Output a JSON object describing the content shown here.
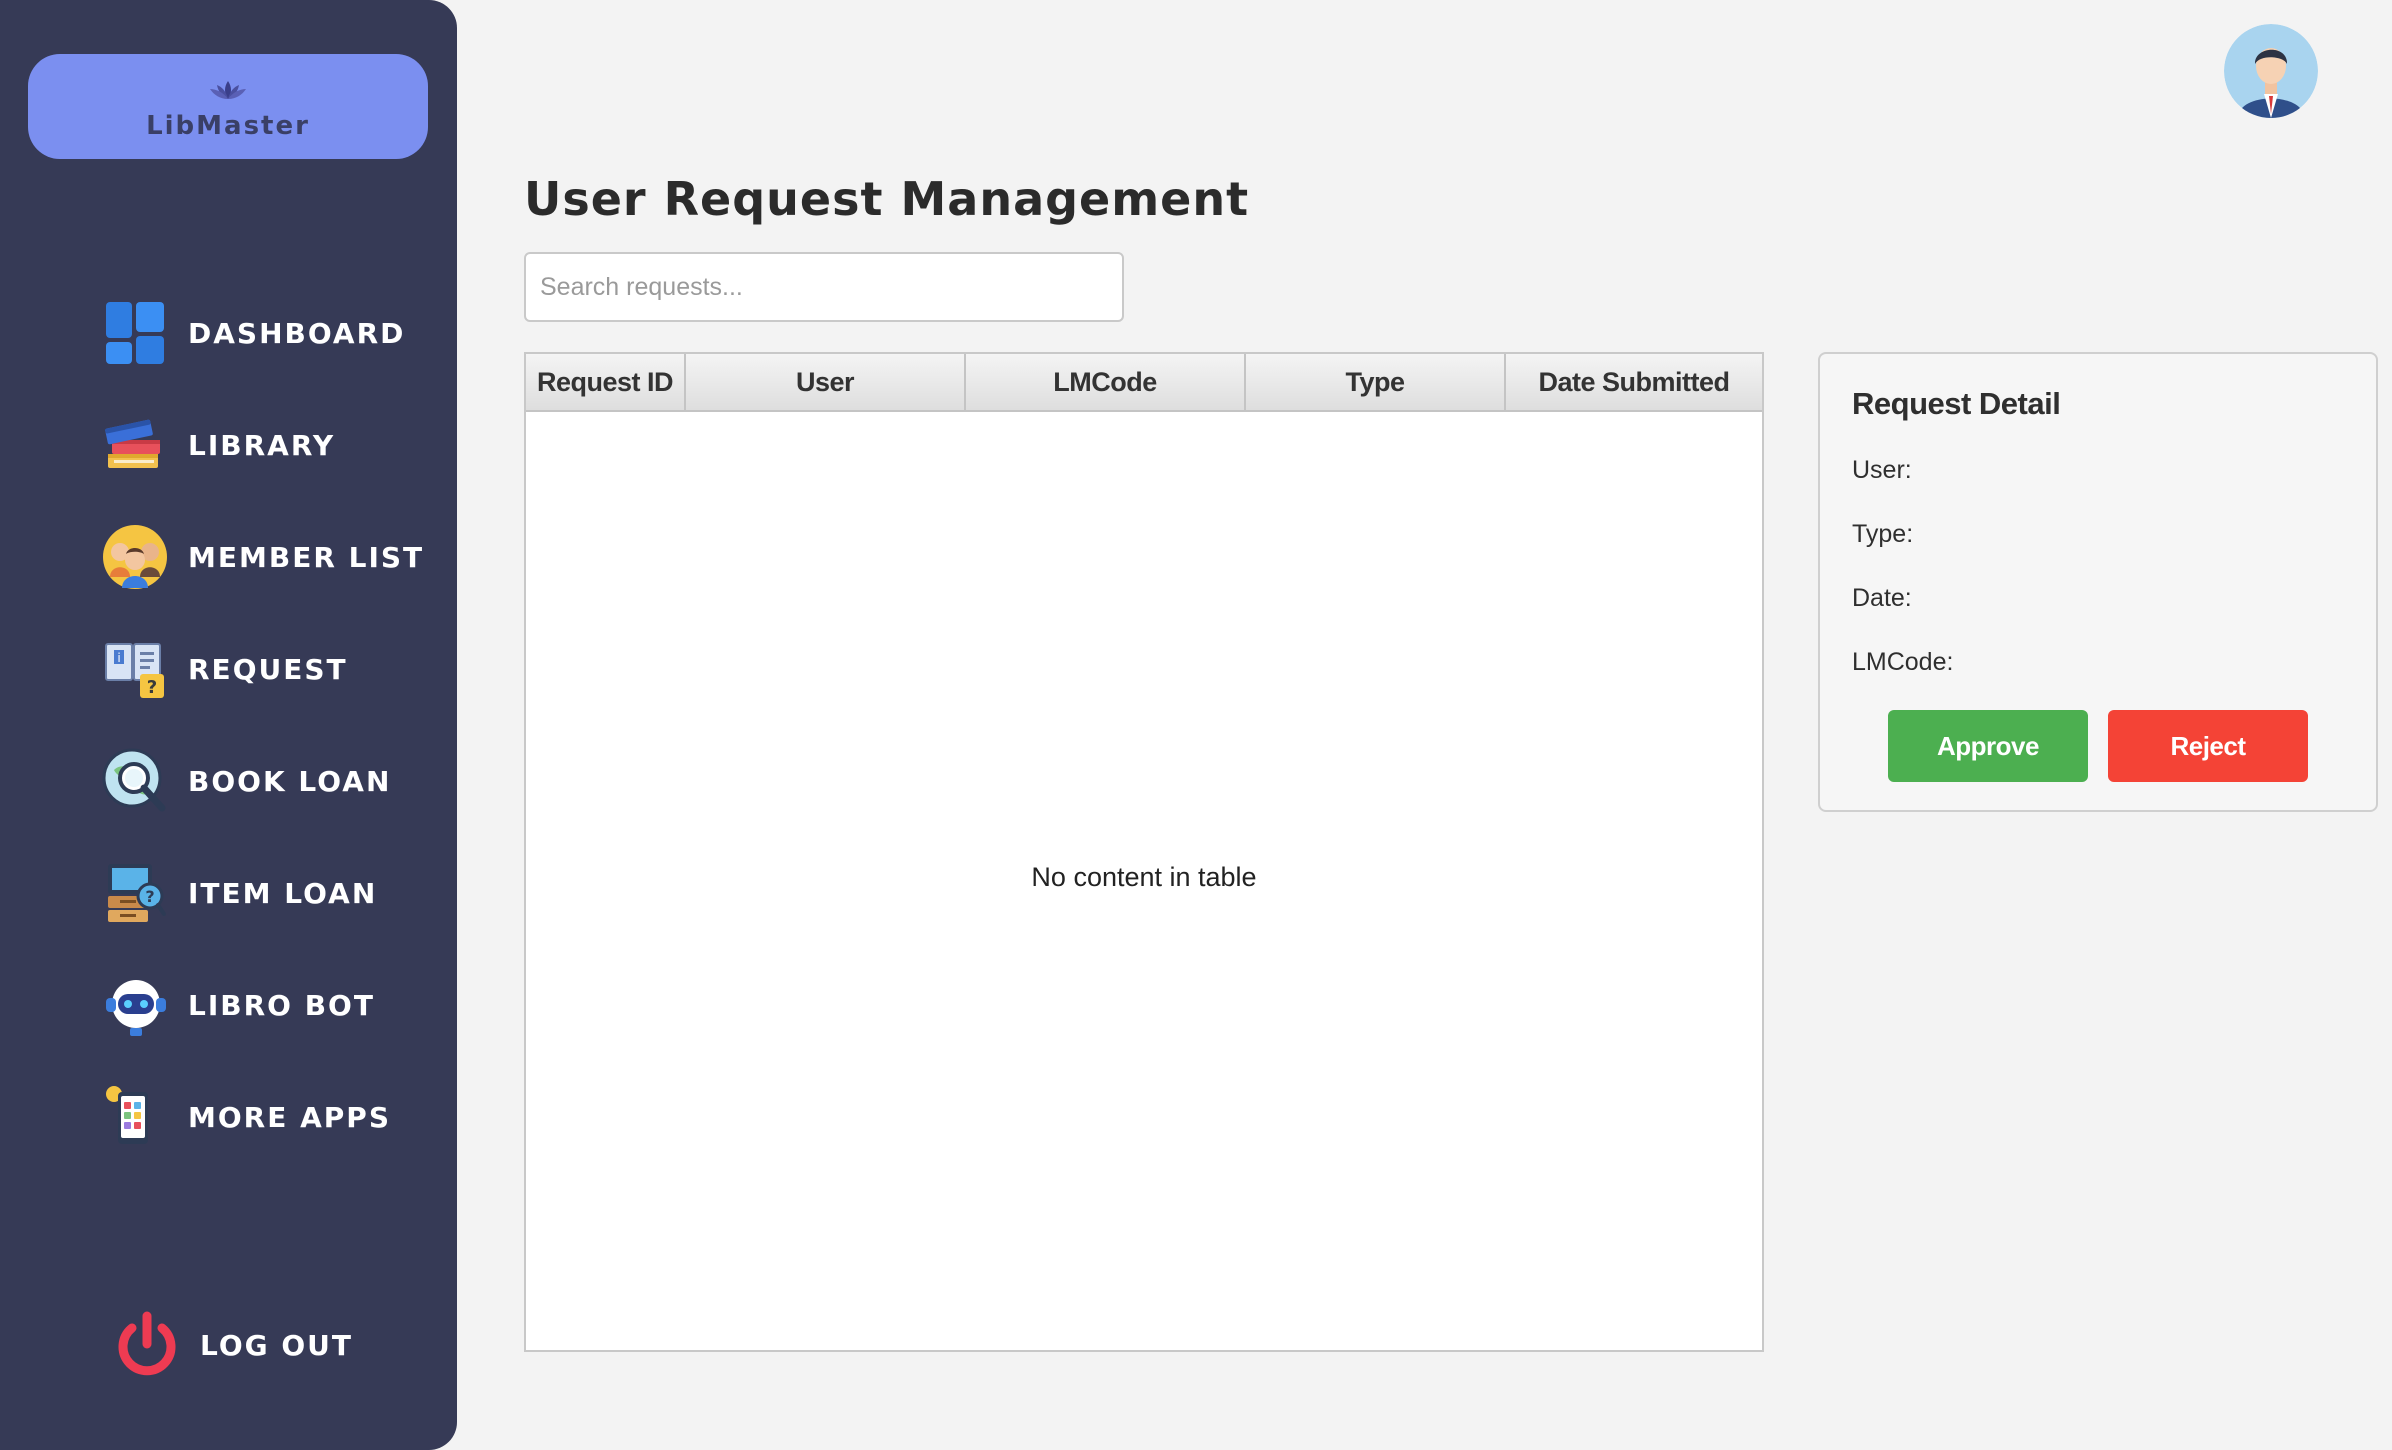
{
  "brand": {
    "name": "LibMaster"
  },
  "sidebar": {
    "items": [
      {
        "label": "DASHBOARD",
        "icon": "dashboard-icon"
      },
      {
        "label": "LIBRARY",
        "icon": "books-icon"
      },
      {
        "label": "MEMBER LIST",
        "icon": "members-icon"
      },
      {
        "label": "REQUEST",
        "icon": "request-icon"
      },
      {
        "label": "BOOK LOAN",
        "icon": "book-loan-icon"
      },
      {
        "label": "ITEM LOAN",
        "icon": "item-loan-icon"
      },
      {
        "label": "LIBRO BOT",
        "icon": "robot-icon"
      },
      {
        "label": "MORE APPS",
        "icon": "apps-icon"
      }
    ],
    "logout": {
      "label": "LOG OUT",
      "icon": "power-icon"
    }
  },
  "header": {
    "title": "User Request Management",
    "avatar_icon": "user-avatar-icon"
  },
  "search": {
    "placeholder": "Search requests..."
  },
  "table": {
    "columns": [
      "Request ID",
      "User",
      "LMCode",
      "Type",
      "Date Submitted"
    ],
    "rows": [],
    "empty_text": "No content in table"
  },
  "detail": {
    "title": "Request Detail",
    "user_label": "User:",
    "type_label": "Type:",
    "date_label": "Date:",
    "lmcode_label": "LMCode:",
    "approve_label": "Approve",
    "reject_label": "Reject"
  },
  "colors": {
    "sidebar_bg": "#363a56",
    "brand_bg": "#7b8ff0",
    "approve": "#4caf50",
    "reject": "#f44336",
    "page_bg": "#f3f3f3"
  }
}
